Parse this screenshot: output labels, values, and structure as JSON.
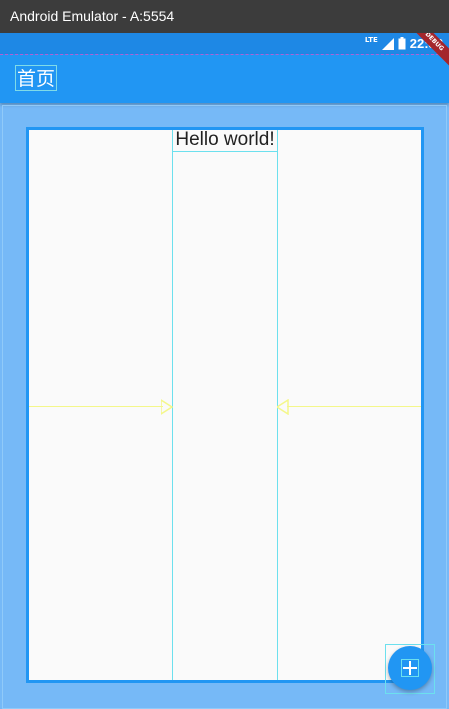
{
  "window": {
    "title": "Android Emulator - A:5554"
  },
  "status_bar": {
    "time": "22:38",
    "network_label": "LTE",
    "icons": [
      "signal-icon",
      "battery-icon"
    ]
  },
  "app_bar": {
    "title": "首页",
    "ribbon": "DEBUG"
  },
  "body": {
    "text": "Hello world!"
  },
  "fab": {
    "icon": "add-icon"
  },
  "colors": {
    "primary": "#2196f3",
    "background": "#76b9f7",
    "card": "#fafafa",
    "guide": "#6ce0ee",
    "arrow": "#f4f78a"
  }
}
